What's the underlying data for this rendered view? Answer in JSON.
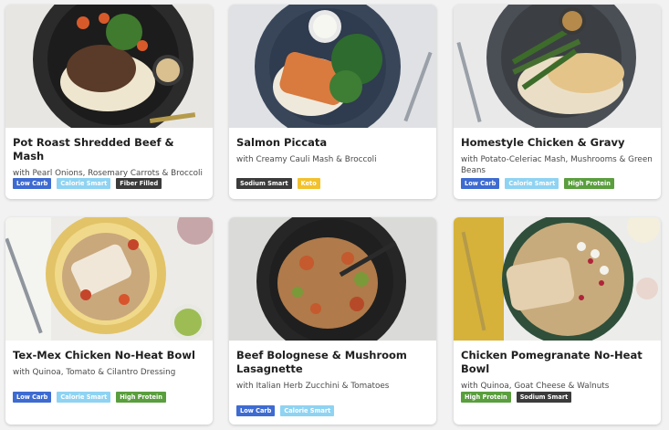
{
  "meals": [
    {
      "title": "Pot Roast Shredded Beef & Mash",
      "subtitle": "with Pearl Onions, Rosemary Carrots & Broccoli",
      "tags": [
        "Low Carb",
        "Calorie Smart",
        "Fiber Filled"
      ]
    },
    {
      "title": "Salmon Piccata",
      "subtitle": "with Creamy Cauli Mash & Broccoli",
      "tags": [
        "Sodium Smart",
        "Keto"
      ]
    },
    {
      "title": "Homestyle Chicken & Gravy",
      "subtitle": "with Potato-Celeriac Mash, Mushrooms & Green Beans",
      "tags": [
        "Low Carb",
        "Calorie Smart",
        "High Protein"
      ]
    },
    {
      "title": "Tex-Mex Chicken No-Heat Bowl",
      "subtitle": "with Quinoa, Tomato & Cilantro Dressing",
      "tags": [
        "Low Carb",
        "Calorie Smart",
        "High Protein"
      ]
    },
    {
      "title": "Beef Bolognese & Mushroom Lasagnette",
      "subtitle": "with Italian Herb Zucchini & Tomatoes",
      "tags": [
        "Low Carb",
        "Calorie Smart"
      ]
    },
    {
      "title": "Chicken Pomegranate No-Heat Bowl",
      "subtitle": "with Quinoa, Goat Cheese & Walnuts",
      "tags": [
        "High Protein",
        "Sodium Smart"
      ]
    }
  ],
  "tag_colors": {
    "Low Carb": "#3e6bd1",
    "Calorie Smart": "#8fd3f2",
    "Fiber Filled": "#3b3b3b",
    "Sodium Smart": "#3b3b3b",
    "Keto": "#f2c12e",
    "High Protein": "#5a9e3e"
  }
}
